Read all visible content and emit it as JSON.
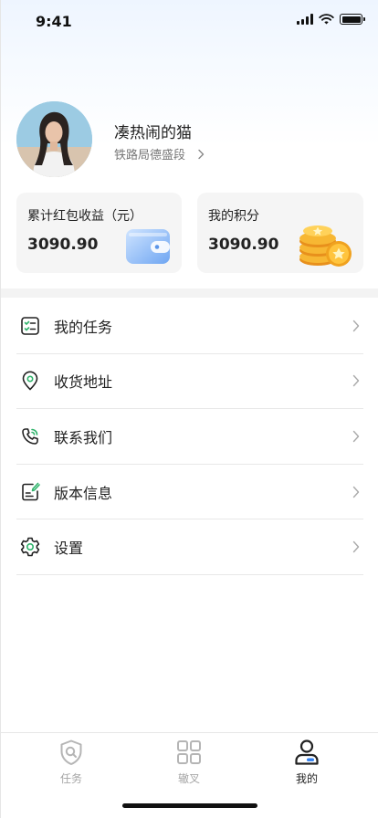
{
  "status_bar": {
    "time": "9:41"
  },
  "profile": {
    "name": "凑热闹的猫",
    "subtitle": "铁路局德盛段"
  },
  "cards": {
    "red_packet": {
      "title": "累计红包收益（元）",
      "value": "3090.90"
    },
    "points": {
      "title": "我的积分",
      "value": "3090.90"
    }
  },
  "menu": {
    "items": [
      {
        "label": "我的任务",
        "icon": "task-list-icon"
      },
      {
        "label": "收货地址",
        "icon": "location-pin-icon"
      },
      {
        "label": "联系我们",
        "icon": "phone-icon"
      },
      {
        "label": "版本信息",
        "icon": "document-edit-icon"
      },
      {
        "label": "设置",
        "icon": "gear-icon"
      }
    ]
  },
  "tabbar": {
    "tabs": [
      {
        "label": "任务",
        "icon": "shield-search-icon",
        "active": false
      },
      {
        "label": "辙叉",
        "icon": "grid-icon",
        "active": false
      },
      {
        "label": "我的",
        "icon": "user-icon",
        "active": true
      }
    ]
  },
  "colors": {
    "accent_green": "#2fb36b",
    "text_primary": "#222222",
    "text_secondary": "#777777",
    "tab_inactive": "#a5a5a5",
    "card_bg": "#f5f5f5"
  }
}
